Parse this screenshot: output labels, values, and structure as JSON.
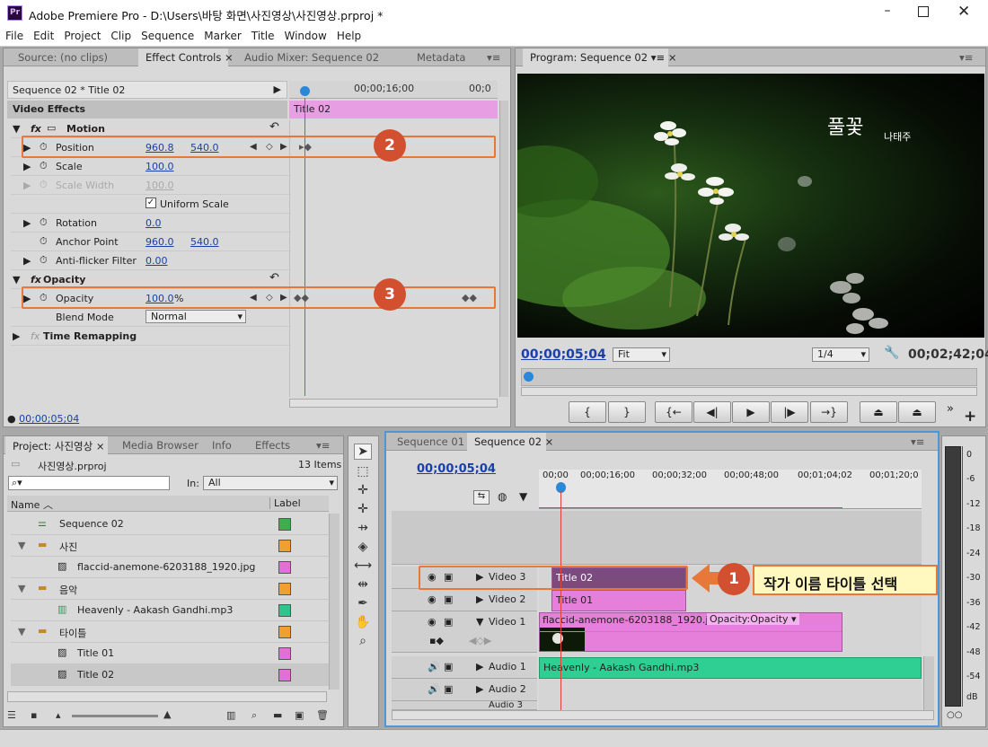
{
  "window": {
    "title": "Adobe Premiere Pro - D:\\Users\\바탕 화면\\사진영상\\사진영상.prproj *",
    "app_icon": "Pr"
  },
  "menu": [
    "File",
    "Edit",
    "Project",
    "Clip",
    "Sequence",
    "Marker",
    "Title",
    "Window",
    "Help"
  ],
  "source_tabs": [
    "Source: (no clips)",
    "Effect Controls",
    "Audio Mixer: Sequence 02",
    "Metadata"
  ],
  "effect_controls": {
    "clip_name": "Sequence 02 * Title 02",
    "ruler_time": "00;00;16;00",
    "ruler_time_end": "00;0",
    "clip_bar": "Title 02",
    "video_effects": "Video Effects",
    "motion": "Motion",
    "position": {
      "label": "Position",
      "x": "960.8",
      "y": "540.0"
    },
    "scale": {
      "label": "Scale",
      "value": "100.0"
    },
    "scale_width": {
      "label": "Scale Width",
      "value": "100.0"
    },
    "uniform_scale": "Uniform Scale",
    "rotation": {
      "label": "Rotation",
      "value": "0.0"
    },
    "anchor": {
      "label": "Anchor Point",
      "x": "960.0",
      "y": "540.0"
    },
    "antiflicker": {
      "label": "Anti-flicker Filter",
      "value": "0.00"
    },
    "opacity_section": "Opacity",
    "opacity": {
      "label": "Opacity",
      "value": "100.0",
      "unit": "%"
    },
    "blend": {
      "label": "Blend Mode",
      "value": "Normal"
    },
    "time_remap": "Time Remapping",
    "timecode": "00;00;05;04"
  },
  "program": {
    "tab": "Program: Sequence 02",
    "title_text": "풀꽃",
    "author_text": "나태주",
    "timecode": "00;00;05;04",
    "fit": "Fit",
    "quality": "1/4",
    "duration": "00;02;42;04"
  },
  "project": {
    "tabs": [
      "Project: 사진영상",
      "Media Browser",
      "Info",
      "Effects"
    ],
    "file": "사진영상.prproj",
    "items_count": "13 Items",
    "in_label": "In:",
    "in_value": "All",
    "col_name": "Name",
    "col_label": "Label",
    "rows": [
      {
        "name": "Sequence 02",
        "color": "#3fae4a"
      },
      {
        "name": "사진",
        "color": "#f0a030"
      },
      {
        "name": "flaccid-anemone-6203188_1920.jpg",
        "color": "#e070d8"
      },
      {
        "name": "음악",
        "color": "#f0a030"
      },
      {
        "name": "Heavenly - Aakash Gandhi.mp3",
        "color": "#2ec48c"
      },
      {
        "name": "타이틀",
        "color": "#f0a030"
      },
      {
        "name": "Title 01",
        "color": "#e070d8"
      },
      {
        "name": "Title 02",
        "color": "#e070d8"
      }
    ]
  },
  "timeline": {
    "tabs": [
      "Sequence 01",
      "Sequence 02"
    ],
    "timecode": "00;00;05;04",
    "ruler": [
      "00;00",
      "00;00;16;00",
      "00;00;32;00",
      "00;00;48;00",
      "00;01;04;02",
      "00;01;20;0"
    ],
    "tracks": {
      "v3": "Video 3",
      "v2": "Video 2",
      "v1": "Video 1",
      "a1": "Audio 1",
      "a2": "Audio 2",
      "a3": "Audio 3"
    },
    "clips": {
      "title02": "Title 02",
      "title01": "Title 01",
      "image": "flaccid-anemone-6203188_1920.jpg",
      "image_fx": "Opacity:Opacity",
      "audio": "Heavenly - Aakash Gandhi.mp3"
    }
  },
  "annotations": {
    "b1": "1",
    "b2": "2",
    "b3": "3",
    "callout": "작가 이름 타이틀 선택"
  },
  "meter": [
    "0",
    "-6",
    "-12",
    "-18",
    "-24",
    "-30",
    "-36",
    "-42",
    "-48",
    "-54",
    "dB"
  ],
  "colors": {
    "accent": "#e8783a",
    "badge": "#d2502f",
    "title_clip": "#e57fd9",
    "title_sel": "#7b4a7e",
    "audio_clip": "#2fcf93",
    "playhead": "#e0413a"
  }
}
